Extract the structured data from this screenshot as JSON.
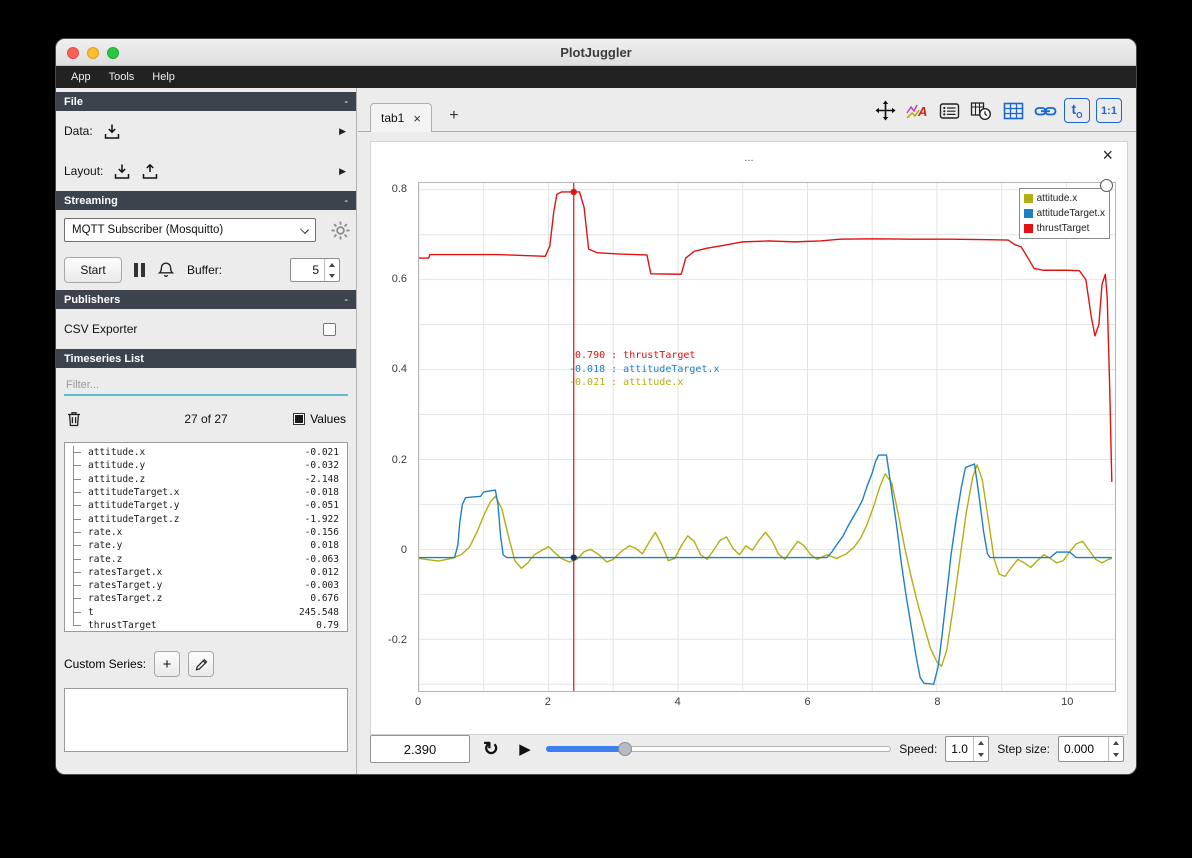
{
  "window": {
    "title": "PlotJuggler"
  },
  "menu": {
    "items": [
      {
        "label": "App"
      },
      {
        "label": "Tools"
      },
      {
        "label": "Help"
      }
    ]
  },
  "icons": {
    "close": "×",
    "plus": "+",
    "chevron": "▶",
    "play": "▶",
    "loop": "↺",
    "t0_main": "t",
    "t0_sub": "O",
    "ratio": "1:1"
  },
  "sidebar": {
    "file": {
      "title": "File",
      "collapse": "-",
      "data_label": "Data:",
      "layout_label": "Layout:"
    },
    "streaming": {
      "title": "Streaming",
      "collapse": "-",
      "source_selected": "MQTT Subscriber (Mosquitto)",
      "start_label": "Start",
      "buffer_label": "Buffer:",
      "buffer_value": "5"
    },
    "publishers": {
      "title": "Publishers",
      "collapse": "-",
      "csv_exporter_label": "CSV Exporter"
    },
    "timeseries": {
      "title": "Timeseries List",
      "filter_placeholder": "Filter...",
      "count": "27 of 27",
      "values_label": "Values",
      "custom_series_label": "Custom Series:",
      "items": [
        {
          "name": "attitude.x",
          "value": "-0.021"
        },
        {
          "name": "attitude.y",
          "value": "-0.032"
        },
        {
          "name": "attitude.z",
          "value": "-2.148"
        },
        {
          "name": "attitudeTarget.x",
          "value": "-0.018"
        },
        {
          "name": "attitudeTarget.y",
          "value": "-0.051"
        },
        {
          "name": "attitudeTarget.z",
          "value": "-1.922"
        },
        {
          "name": "rate.x",
          "value": "-0.156"
        },
        {
          "name": "rate.y",
          "value": "0.018"
        },
        {
          "name": "rate.z",
          "value": "-0.063"
        },
        {
          "name": "ratesTarget.x",
          "value": "0.012"
        },
        {
          "name": "ratesTarget.y",
          "value": "-0.003"
        },
        {
          "name": "ratesTarget.z",
          "value": "0.676"
        },
        {
          "name": "t",
          "value": "245.548"
        },
        {
          "name": "thrustTarget",
          "value": "0.79"
        }
      ]
    }
  },
  "main": {
    "tabs": [
      {
        "label": "tab1"
      }
    ],
    "plot": {
      "title": "...",
      "legend": [
        {
          "label": "attitude.x",
          "color": "#b3ae12"
        },
        {
          "label": "attitudeTarget.x",
          "color": "#1f7fc4"
        },
        {
          "label": "thrustTarget",
          "color": "#e11212"
        }
      ],
      "tracker_annotations": [
        {
          "text": " 0.790 : thrustTarget",
          "color": "#e11212"
        },
        {
          "text": "-0.018 : attitudeTarget.x",
          "color": "#1f7fc4"
        },
        {
          "text": "-0.021 : attitude.x",
          "color": "#b3ae12"
        }
      ]
    }
  },
  "bottom_bar": {
    "time_value": "2.390",
    "speed_label": "Speed:",
    "speed_value": "1.0",
    "step_label": "Step size:",
    "step_value": "0.000"
  },
  "chart_data": {
    "type": "line",
    "xlim": [
      0,
      10.75
    ],
    "ylim": [
      -0.315,
      0.815
    ],
    "x_ticks": [
      0,
      2,
      4,
      6,
      8,
      10
    ],
    "y_ticks": [
      -0.2,
      0,
      0.2,
      0.4,
      0.6,
      0.8
    ],
    "x_grid_step": 1,
    "y_grid_step": 0.1,
    "grid": true,
    "legend_position": "top-right",
    "tracker": {
      "x": 2.39,
      "dots": [
        {
          "y": 0.795,
          "color": "#e11212"
        },
        {
          "y": -0.018,
          "color": "#16355e"
        }
      ]
    },
    "series": [
      {
        "name": "attitude.x",
        "color": "#b3ae12",
        "points": [
          [
            0,
            -0.02
          ],
          [
            0.3,
            -0.026
          ],
          [
            0.5,
            -0.02
          ],
          [
            0.65,
            -0.012
          ],
          [
            0.78,
            0.005
          ],
          [
            0.9,
            0.04
          ],
          [
            1.0,
            0.075
          ],
          [
            1.1,
            0.105
          ],
          [
            1.18,
            0.118
          ],
          [
            1.28,
            0.09
          ],
          [
            1.38,
            0.03
          ],
          [
            1.48,
            -0.025
          ],
          [
            1.58,
            -0.042
          ],
          [
            1.68,
            -0.03
          ],
          [
            1.78,
            -0.012
          ],
          [
            1.9,
            -0.002
          ],
          [
            2.0,
            0.006
          ],
          [
            2.1,
            -0.008
          ],
          [
            2.2,
            -0.02
          ],
          [
            2.32,
            -0.028
          ],
          [
            2.44,
            -0.022
          ],
          [
            2.55,
            -0.005
          ],
          [
            2.65,
            0.0
          ],
          [
            2.78,
            -0.012
          ],
          [
            2.9,
            -0.028
          ],
          [
            3.0,
            -0.022
          ],
          [
            3.12,
            -0.005
          ],
          [
            3.25,
            0.008
          ],
          [
            3.35,
            0.002
          ],
          [
            3.45,
            -0.01
          ],
          [
            3.55,
            0.015
          ],
          [
            3.65,
            0.038
          ],
          [
            3.75,
            0.01
          ],
          [
            3.85,
            -0.025
          ],
          [
            3.95,
            -0.02
          ],
          [
            4.05,
            0.008
          ],
          [
            4.15,
            0.03
          ],
          [
            4.25,
            0.018
          ],
          [
            4.35,
            -0.012
          ],
          [
            4.45,
            -0.022
          ],
          [
            4.55,
            -0.002
          ],
          [
            4.65,
            0.02
          ],
          [
            4.75,
            0.028
          ],
          [
            4.85,
            0.002
          ],
          [
            4.95,
            -0.012
          ],
          [
            5.05,
            0.008
          ],
          [
            5.15,
            -0.002
          ],
          [
            5.25,
            0.02
          ],
          [
            5.35,
            0.038
          ],
          [
            5.45,
            0.02
          ],
          [
            5.55,
            -0.01
          ],
          [
            5.65,
            -0.022
          ],
          [
            5.75,
            -0.002
          ],
          [
            5.85,
            0.018
          ],
          [
            5.95,
            0.008
          ],
          [
            6.05,
            -0.012
          ],
          [
            6.15,
            -0.022
          ],
          [
            6.3,
            -0.012
          ],
          [
            6.45,
            -0.02
          ],
          [
            6.6,
            -0.01
          ],
          [
            6.72,
            0.005
          ],
          [
            6.82,
            0.025
          ],
          [
            6.92,
            0.055
          ],
          [
            7.02,
            0.095
          ],
          [
            7.12,
            0.14
          ],
          [
            7.2,
            0.168
          ],
          [
            7.3,
            0.148
          ],
          [
            7.4,
            0.08
          ],
          [
            7.5,
            0.005
          ],
          [
            7.6,
            -0.06
          ],
          [
            7.7,
            -0.12
          ],
          [
            7.8,
            -0.17
          ],
          [
            7.9,
            -0.22
          ],
          [
            8.0,
            -0.25
          ],
          [
            8.07,
            -0.26
          ],
          [
            8.15,
            -0.225
          ],
          [
            8.25,
            -0.13
          ],
          [
            8.35,
            -0.025
          ],
          [
            8.45,
            0.08
          ],
          [
            8.55,
            0.16
          ],
          [
            8.62,
            0.188
          ],
          [
            8.7,
            0.155
          ],
          [
            8.8,
            0.06
          ],
          [
            8.88,
            -0.02
          ],
          [
            8.96,
            -0.055
          ],
          [
            9.05,
            -0.06
          ],
          [
            9.15,
            -0.04
          ],
          [
            9.25,
            -0.022
          ],
          [
            9.35,
            -0.03
          ],
          [
            9.45,
            -0.04
          ],
          [
            9.55,
            -0.025
          ],
          [
            9.65,
            -0.012
          ],
          [
            9.75,
            -0.02
          ],
          [
            9.85,
            -0.03
          ],
          [
            9.95,
            -0.025
          ],
          [
            10.05,
            -0.005
          ],
          [
            10.15,
            0.012
          ],
          [
            10.25,
            0.018
          ],
          [
            10.35,
            -0.002
          ],
          [
            10.45,
            -0.022
          ],
          [
            10.55,
            -0.03
          ],
          [
            10.65,
            -0.022
          ],
          [
            10.7,
            -0.02
          ]
        ]
      },
      {
        "name": "attitudeTarget.x",
        "color": "#1f7fc4",
        "points": [
          [
            0,
            -0.018
          ],
          [
            0.55,
            -0.018
          ],
          [
            0.6,
            0.01
          ],
          [
            0.63,
            0.06
          ],
          [
            0.67,
            0.1
          ],
          [
            0.72,
            0.115
          ],
          [
            0.95,
            0.118
          ],
          [
            1.0,
            0.128
          ],
          [
            1.18,
            0.132
          ],
          [
            1.22,
            0.1
          ],
          [
            1.26,
            0.03
          ],
          [
            1.3,
            -0.012
          ],
          [
            1.35,
            -0.018
          ],
          [
            6.3,
            -0.018
          ],
          [
            6.38,
            -0.005
          ],
          [
            6.45,
            0.01
          ],
          [
            6.55,
            0.03
          ],
          [
            6.62,
            0.05
          ],
          [
            6.7,
            0.07
          ],
          [
            6.78,
            0.09
          ],
          [
            6.85,
            0.11
          ],
          [
            6.92,
            0.14
          ],
          [
            7.0,
            0.17
          ],
          [
            7.05,
            0.195
          ],
          [
            7.1,
            0.21
          ],
          [
            7.22,
            0.21
          ],
          [
            7.3,
            0.13
          ],
          [
            7.38,
            0.05
          ],
          [
            7.45,
            -0.03
          ],
          [
            7.52,
            -0.1
          ],
          [
            7.6,
            -0.17
          ],
          [
            7.68,
            -0.24
          ],
          [
            7.74,
            -0.285
          ],
          [
            7.8,
            -0.298
          ],
          [
            7.95,
            -0.3
          ],
          [
            8.02,
            -0.26
          ],
          [
            8.08,
            -0.19
          ],
          [
            8.15,
            -0.1
          ],
          [
            8.22,
            -0.01
          ],
          [
            8.3,
            0.07
          ],
          [
            8.38,
            0.14
          ],
          [
            8.44,
            0.182
          ],
          [
            8.58,
            0.19
          ],
          [
            8.65,
            0.12
          ],
          [
            8.72,
            0.04
          ],
          [
            8.78,
            -0.01
          ],
          [
            8.82,
            -0.018
          ],
          [
            9.75,
            -0.018
          ],
          [
            9.85,
            -0.006
          ],
          [
            10.05,
            -0.006
          ],
          [
            10.15,
            -0.018
          ],
          [
            10.7,
            -0.018
          ]
        ]
      },
      {
        "name": "thrustTarget",
        "color": "#e11212",
        "points": [
          [
            0,
            0.648
          ],
          [
            0.15,
            0.648
          ],
          [
            0.17,
            0.656
          ],
          [
            1.2,
            0.656
          ],
          [
            1.95,
            0.652
          ],
          [
            2.02,
            0.675
          ],
          [
            2.08,
            0.75
          ],
          [
            2.13,
            0.79
          ],
          [
            2.2,
            0.795
          ],
          [
            2.48,
            0.795
          ],
          [
            2.55,
            0.76
          ],
          [
            2.62,
            0.668
          ],
          [
            2.75,
            0.66
          ],
          [
            3.1,
            0.657
          ],
          [
            3.52,
            0.655
          ],
          [
            3.58,
            0.613
          ],
          [
            4.05,
            0.612
          ],
          [
            4.12,
            0.648
          ],
          [
            4.25,
            0.663
          ],
          [
            4.45,
            0.67
          ],
          [
            4.7,
            0.676
          ],
          [
            5.0,
            0.684
          ],
          [
            5.4,
            0.686
          ],
          [
            5.8,
            0.684
          ],
          [
            6.2,
            0.686
          ],
          [
            6.5,
            0.69
          ],
          [
            7.0,
            0.691
          ],
          [
            7.6,
            0.69
          ],
          [
            8.2,
            0.69
          ],
          [
            8.8,
            0.689
          ],
          [
            9.1,
            0.688
          ],
          [
            9.2,
            0.678
          ],
          [
            9.3,
            0.673
          ],
          [
            9.4,
            0.65
          ],
          [
            9.5,
            0.625
          ],
          [
            9.65,
            0.621
          ],
          [
            10.0,
            0.621
          ],
          [
            10.2,
            0.62
          ],
          [
            10.3,
            0.6
          ],
          [
            10.38,
            0.52
          ],
          [
            10.44,
            0.475
          ],
          [
            10.5,
            0.5
          ],
          [
            10.55,
            0.59
          ],
          [
            10.6,
            0.612
          ],
          [
            10.63,
            0.56
          ],
          [
            10.67,
            0.35
          ],
          [
            10.7,
            0.15
          ]
        ]
      }
    ]
  }
}
